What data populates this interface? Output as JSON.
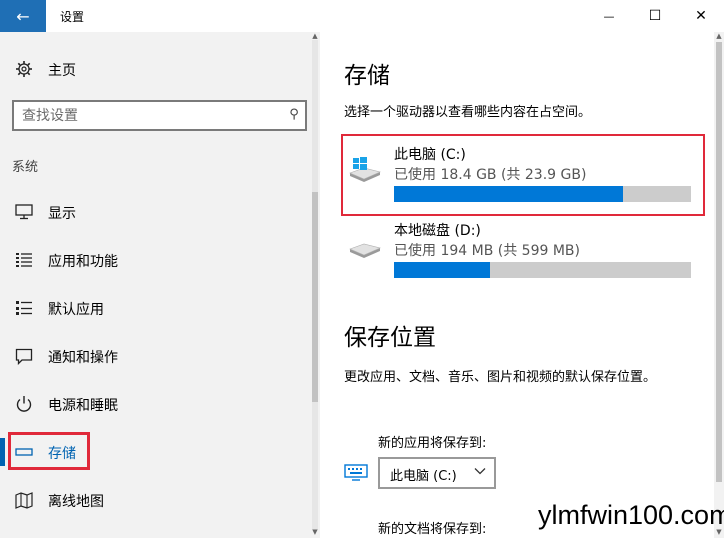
{
  "window": {
    "title": "设置",
    "back_glyph": "←",
    "minimize_glyph": "—",
    "maximize_glyph": "☐",
    "close_glyph": "✕"
  },
  "nav": {
    "home_label": "主页",
    "search_placeholder": "查找设置",
    "section_label": "系统",
    "items": [
      {
        "label": "显示",
        "icon": "monitor-icon"
      },
      {
        "label": "应用和功能",
        "icon": "list-icon"
      },
      {
        "label": "默认应用",
        "icon": "list-check-icon"
      },
      {
        "label": "通知和操作",
        "icon": "chat-icon"
      },
      {
        "label": "电源和睡眠",
        "icon": "power-icon"
      },
      {
        "label": "存储",
        "icon": "storage-icon",
        "selected": true
      },
      {
        "label": "离线地图",
        "icon": "map-icon"
      }
    ]
  },
  "content": {
    "storage_title": "存储",
    "storage_desc": "选择一个驱动器以查看哪些内容在占空间。",
    "drives": [
      {
        "name": "此电脑 (C:)",
        "usage": "已使用 18.4 GB (共 23.9 GB)",
        "used": 18.4,
        "total": 23.9,
        "highlighted": true
      },
      {
        "name": "本地磁盘 (D:)",
        "usage": "已使用 194 MB (共 599 MB)",
        "used": 194,
        "total": 599,
        "highlighted": false
      }
    ],
    "save_location_title": "保存位置",
    "save_location_desc": "更改应用、文档、音乐、图片和视频的默认保存位置。",
    "new_apps_label": "新的应用将保存到:",
    "new_apps_value": "此电脑 (C:)",
    "new_docs_label": "新的文档将保存到:"
  },
  "watermark": "ylmfwin100.com",
  "colors": {
    "accent": "#0078d7",
    "title_accent": "#1f6fb5",
    "highlight_red": "#e0293a",
    "bar_track": "#cccccc"
  }
}
